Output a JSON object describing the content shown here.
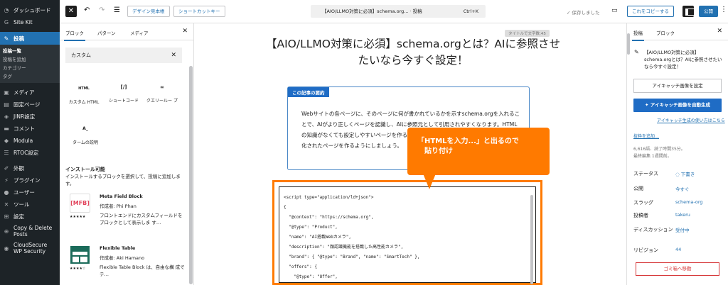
{
  "admin_menu": {
    "items_top": [
      {
        "icon": "dashboard-icon",
        "glyph": "◔",
        "label": "ダッシュボード"
      },
      {
        "icon": "sitekit-icon",
        "glyph": "G",
        "label": "Site Kit"
      }
    ],
    "current": {
      "icon": "pin-icon",
      "glyph": "✎",
      "label": "投稿"
    },
    "submenu": [
      "投稿一覧",
      "投稿を追加",
      "カテゴリー",
      "タグ"
    ],
    "items": [
      {
        "icon": "media-icon",
        "glyph": "▣",
        "label": "メディア"
      },
      {
        "icon": "page-icon",
        "glyph": "▤",
        "label": "固定ページ"
      },
      {
        "icon": "jinr-icon",
        "glyph": "◈",
        "label": "JINR設定"
      },
      {
        "icon": "comment-icon",
        "glyph": "▬",
        "label": "コメント"
      },
      {
        "icon": "modula-icon",
        "glyph": "◆",
        "label": "Modula"
      },
      {
        "icon": "rtoc-icon",
        "glyph": "☰",
        "label": "RTOC設定"
      }
    ],
    "items2": [
      {
        "icon": "appearance-icon",
        "glyph": "✐",
        "label": "外観"
      },
      {
        "icon": "plugin-icon",
        "glyph": "⚡",
        "label": "プラグイン"
      },
      {
        "icon": "user-icon",
        "glyph": "●",
        "label": "ユーザー"
      },
      {
        "icon": "tool-icon",
        "glyph": "✕",
        "label": "ツール"
      },
      {
        "icon": "settings-icon",
        "glyph": "⊞",
        "label": "設定"
      }
    ],
    "copy_delete": {
      "icon": "copy-icon",
      "glyph": "⊕",
      "label": "Copy & Delete Posts"
    },
    "cloudsecure": {
      "icon": "cloudsecure-icon",
      "glyph": "◉",
      "label": "CloudSecure WP Security"
    }
  },
  "topbar": {
    "pattern_btn": "デザイン見本帳",
    "shortcut_btn": "ショートカットキー",
    "doc_title": "【AIO/LLMO対策に必須】schema.org...",
    "doc_type": "· 投稿",
    "doc_shortcut": "Ctrl+K",
    "saved": "✓ 保存しました",
    "copy_btn": "これをコピーする",
    "publish": "公開"
  },
  "inserter": {
    "tabs": [
      "ブロック",
      "パターン",
      "メディア"
    ],
    "search_value": "カスタム",
    "blocks": [
      {
        "icon_text": "HTML",
        "label": "カスタム HTML"
      },
      {
        "icon_text": "[/]",
        "label": "ショートコード"
      },
      {
        "icon_text": "∞",
        "label": "クエリールー プ"
      },
      {
        "icon_text": "A_",
        "label": "タームの説明"
      }
    ],
    "install_heading": "インストール可能",
    "install_desc": "インストールするブロックを選択して、投稿に追加します。",
    "plugins": [
      {
        "name": "Meta Field Block",
        "author": "作成者: Phi Phan",
        "desc": "フロントエンドにカスタムフィールドをブロックとして表示しま す…",
        "logo_text": "[MFB]",
        "rating": "★★★★★"
      },
      {
        "name": "Flexible Table",
        "author": "作成者: Aki Hamano",
        "desc": "Flexible Table Block は、自由な構 成でテ…",
        "logo_text": "",
        "rating": "★★★★☆"
      }
    ]
  },
  "editor": {
    "word_count": "タイトルで文字数:45",
    "title": "【AIO/LLMO対策に必須】schema.orgとは？AIに参照させたいなら今すぐ設定！",
    "summary_label": "この記事の要約",
    "summary_text": "Webサイトの各ページに、そのページに何が書かれているかを示すschema.orgを入れることで、AIがより正しくページを認識し、AIに参照元として引用されやすくなります。HTMLの知識がなくても設定しやすいページを作ることに加え、schema.orgを使ってAIにも最適化されたページを作るようにしましょう。",
    "callout_line1": "「HTMLを入力...」と出るので",
    "callout_line2": "貼り付け",
    "code_lines": [
      "<script type=\"application/ld+json\">",
      "{",
      "  \"@context\": \"https://schema.org\",",
      "  \"@type\": \"Product\",",
      "  \"name\": \"AI搭載Webカメラ\",",
      "  \"description\": \"顔認識機能を搭載した高性能カメラ\",",
      "  \"brand\": { \"@type\": \"Brand\", \"name\": \"SmartTech\" },",
      "  \"offers\": {",
      "    \"@type\": \"Offer\","
    ]
  },
  "settings": {
    "tabs": [
      "投稿",
      "ブロック"
    ],
    "post_title": "【AIO/LLMO対策に必須】schema.orgとは？AIに参照させたいなら今すぐ設定！",
    "featured_btn": "アイキャッチ画像を設定",
    "auto_btn": "アイキャッチ画像を自動生成",
    "auto_link": "アイキャッチ生成の使い方はこちら",
    "excerpt_link": "抜粋を追加…",
    "meta_line1": "6,616語、読了時間35分。",
    "meta_line2": "最終編集 1週間前。",
    "rows": [
      {
        "label": "ステータス",
        "value": "下書き"
      },
      {
        "label": "公開",
        "value": "今すぐ"
      },
      {
        "label": "スラッグ",
        "value": "schema-org"
      },
      {
        "label": "投稿者",
        "value": "takeru"
      },
      {
        "label": "ディスカッション",
        "value": "受付中"
      },
      {
        "label": "リビジョン",
        "value": "44"
      }
    ],
    "trash_btn": "ゴミ箱へ移動"
  },
  "colors": {
    "accent": "#2271b1",
    "callout": "#ff7a00",
    "summary_label": "#1f6cc5",
    "admin_bg": "#1d2327"
  }
}
